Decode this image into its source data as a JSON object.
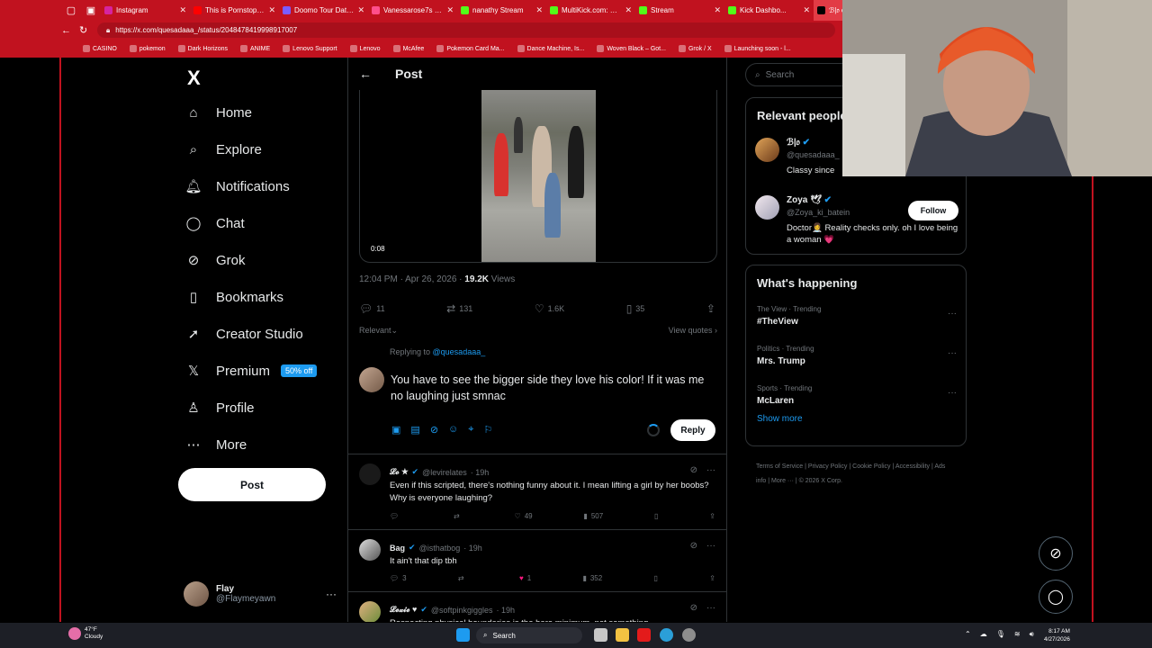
{
  "browser": {
    "tabs": [
      {
        "title": "Instagram",
        "color": "#d6249f",
        "active": false
      },
      {
        "title": "This is Pornstop b...",
        "color": "#ff0000",
        "active": false
      },
      {
        "title": "Doomo Tour Dates 20...",
        "color": "#7a5cff",
        "active": false
      },
      {
        "title": "Vanessarose7s Free C...",
        "color": "#ff4f8b",
        "active": false
      },
      {
        "title": "nanathy Stream",
        "color": "#53fc18",
        "active": false
      },
      {
        "title": "MultiKick.com: Watch...",
        "color": "#53fc18",
        "active": false
      },
      {
        "title": "Stream",
        "color": "#53fc18",
        "active": false
      },
      {
        "title": "Kick Dashbo...",
        "color": "#53fc18",
        "active": false
      },
      {
        "title": "ℬ|𝔬 on X: \"When peo...",
        "color": "#000000",
        "active": true
      },
      {
        "title": "Looking...",
        "color": "#ff0000",
        "active": false
      }
    ],
    "url": "https://x.com/quesadaaa_/status/2048478419998917007",
    "bookmarks": [
      "CASINO",
      "pokemon",
      "Dark Horizons",
      "ANIME",
      "Lenovo Support",
      "Lenovo",
      "McAfee",
      "Pokemon Card Ma...",
      "Dance Machine, Is...",
      "Woven Black – Got...",
      "Grok / X",
      "Launching soon - l..."
    ]
  },
  "nav": {
    "logo": "X",
    "items": [
      {
        "label": "Home",
        "icon": "home-icon",
        "glyph": "⌂"
      },
      {
        "label": "Explore",
        "icon": "search-icon",
        "glyph": "⌕"
      },
      {
        "label": "Notifications",
        "icon": "bell-icon",
        "glyph": "🔔︎"
      },
      {
        "label": "Chat",
        "icon": "chat-icon",
        "glyph": "◯"
      },
      {
        "label": "Grok",
        "icon": "grok-icon",
        "glyph": "⊘"
      },
      {
        "label": "Bookmarks",
        "icon": "bookmark-icon",
        "glyph": "▯"
      },
      {
        "label": "Creator Studio",
        "icon": "rocket-icon",
        "glyph": "➚"
      },
      {
        "label": "Premium",
        "icon": "x-logo-icon",
        "glyph": "𝕏"
      },
      {
        "label": "Profile",
        "icon": "person-icon",
        "glyph": "♙"
      },
      {
        "label": "More",
        "icon": "more-circle-icon",
        "glyph": "⋯"
      }
    ],
    "premium_badge": "50% off",
    "post_label": "Post",
    "account": {
      "name": "Flay",
      "handle": "@Flaymeyawn",
      "more": "···"
    }
  },
  "post": {
    "header_title": "Post",
    "video_time": "0:08",
    "time": "12:04 PM · Apr 26, 2026 · ",
    "views_count": "19.2K",
    "views_label": " Views",
    "stats": {
      "replies": "11",
      "reposts": "131",
      "likes": "1.6K",
      "bookmarks": "35"
    },
    "sort_label": "Relevant",
    "view_quotes": "View quotes",
    "replying_to_prefix": "Replying to ",
    "replying_to_handle": "@quesadaaa_",
    "draft_text": "You have to see the bigger side they love his color! If it was me no laughing just smnac",
    "reply_button": "Reply"
  },
  "replies": [
    {
      "name": "𝓛𝓸 ★",
      "handle": "@levirelates",
      "time": "· 19h",
      "text": "Even if this scripted, there's nothing funny about it. I mean lifting a girl by her boobs? Why is everyone laughing?",
      "replies": "",
      "reposts": "",
      "likes": "49",
      "views": "507",
      "liked": false
    },
    {
      "name": "Bag",
      "handle": "@isthatbog",
      "time": "· 19h",
      "text": "It ain't that dip tbh",
      "replies": "3",
      "reposts": "",
      "likes": "1",
      "views": "352",
      "liked": true
    },
    {
      "name": "𝓛𝓮𝔁𝓲𝓮 ♥",
      "handle": "@softpinkgiggles",
      "time": "· 19h",
      "text": "Respecting physical boundaries is the bare minimum, not something",
      "replies": "",
      "reposts": "",
      "likes": "",
      "views": "",
      "liked": false
    }
  ],
  "sidebar": {
    "search_placeholder": "Search",
    "relevant_title": "Relevant people",
    "people": [
      {
        "name": "ℬ|𝔬",
        "handle": "@quesadaaa_",
        "bio": "Classy since",
        "color": "#a8702e"
      },
      {
        "name": "Zoya 🕊",
        "handle": "@Zoya_ki_batein",
        "bio": "Doctor👩‍⚕️ Reality checks only. oh I love being a woman 💗",
        "color": "#d9cfe0",
        "follow": "Follow"
      }
    ],
    "happening_title": "What's happening",
    "trends": [
      {
        "category": "The View · Trending",
        "name": "#TheView"
      },
      {
        "category": "Politics · Trending",
        "name": "Mrs. Trump"
      },
      {
        "category": "Sports · Trending",
        "name": "McLaren"
      }
    ],
    "show_more": "Show more",
    "footer": [
      "Terms of Service",
      "Privacy Policy",
      "Cookie Policy",
      "Accessibility",
      "Ads info",
      "More ···",
      "© 2026 X Corp."
    ]
  },
  "taskbar": {
    "weather_temp": "47°F",
    "weather_desc": "Cloudy",
    "search_label": "Search",
    "time": "8:17 AM",
    "date": "4/27/2026"
  },
  "colors": {
    "accent": "#1d9bf0",
    "browser_red": "#c1121f",
    "like_pink": "#f91880"
  }
}
